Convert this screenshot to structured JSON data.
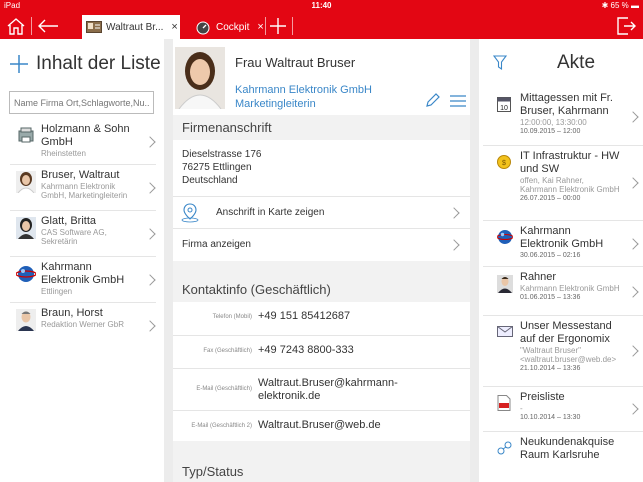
{
  "status": {
    "device": "iPad",
    "time": "11:40",
    "battery": "65 %"
  },
  "tabs": [
    {
      "label": "Waltraut Br...",
      "close": "×"
    },
    {
      "label": "Cockpit",
      "close": "×"
    }
  ],
  "left": {
    "title": "Inhalt der Liste",
    "search_placeholder": "Name Firma Ort,Schlagworte,Nu...",
    "items": [
      {
        "title": "Holzmann & Sohn GmbH",
        "sub": "Rheinstetten",
        "icon": "company-icon"
      },
      {
        "title": "Bruser, Waltraut",
        "sub": "Kahrmann Elektronik GmbH, Marketingleiterin",
        "icon": "avatar"
      },
      {
        "title": "Glatt, Britta",
        "sub": "CAS Software AG, Sekretärin",
        "icon": "avatar"
      },
      {
        "title": "Kahrmann Elektronik GmbH",
        "sub": "Ettlingen",
        "icon": "globe-icon"
      },
      {
        "title": "Braun, Horst",
        "sub": "Redaktion Werner GbR",
        "icon": "avatar"
      }
    ]
  },
  "contact": {
    "name": "Frau Waltraut Bruser",
    "company": "Kahrmann Elektronik GmbH",
    "role": "Marketingleiterin",
    "address_header": "Firmenanschrift",
    "address": [
      "Dieselstrasse 176",
      "76275 Ettlingen",
      "Deutschland"
    ],
    "map_label": "Anschrift in Karte zeigen",
    "company_label": "Firma anzeigen",
    "contact_header": "Kontaktinfo (Geschäftlich)",
    "fields": [
      {
        "label": "Telefon (Mobil)",
        "value": "+49 151 85412687"
      },
      {
        "label": "Fax (Geschäftlich)",
        "value": "+49 7243 8800-333"
      },
      {
        "label": "E-Mail (Geschäftlich)",
        "value": "Waltraut.Bruser@kahrmann-elektronik.de"
      },
      {
        "label": "E-Mail (Geschäftlich 2)",
        "value": "Waltraut.Bruser@web.de"
      }
    ],
    "type_header": "Typ/Status"
  },
  "right": {
    "title": "Akte",
    "items": [
      {
        "title": "Mittagessen mit Fr. Bruser, Kahrmann",
        "sub": "12:00:00, 13:30:00",
        "date": "10.09.2015 – 12:00",
        "icon": "calendar-icon"
      },
      {
        "title": "IT Infrastruktur - HW und SW",
        "sub": "offen, Kai Rahner, Kahrmann Elektronik GmbH",
        "date": "26.07.2015 – 00:00",
        "icon": "coin-icon"
      },
      {
        "title": "Kahrmann Elektronik GmbH",
        "sub": "",
        "date": "30.06.2015 – 02:16",
        "icon": "globe-icon"
      },
      {
        "title": "Rahner",
        "sub": "Kahrmann Elektronik GmbH",
        "date": "01.06.2015 – 13:36",
        "icon": "avatar"
      },
      {
        "title": "Unser Messestand auf der Ergonomix",
        "sub": "\"Waltraut Bruser\" <waltraut.bruser@web.de>",
        "date": "21.10.2014 – 13:36",
        "icon": "email-icon"
      },
      {
        "title": "Preisliste",
        "sub": "-",
        "date": "10.10.2014 – 13:30",
        "icon": "pdf-icon"
      },
      {
        "title": "Neukundenakquise Raum Karlsruhe",
        "sub": "",
        "date": "",
        "icon": "process-icon"
      }
    ]
  },
  "colors": {
    "accent": "#e30613",
    "link": "#3a87c8"
  }
}
